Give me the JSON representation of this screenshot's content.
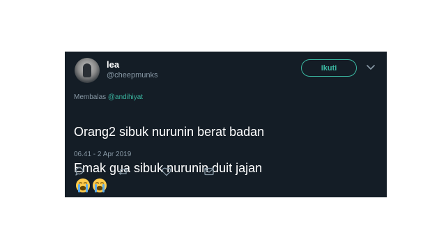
{
  "tweet": {
    "display_name": "lea",
    "handle": "@cheepmunks",
    "follow_label": "Ikuti",
    "reply_prefix": "Membalas ",
    "reply_to": "@andihiyat",
    "text_line1": "Orang2 sibuk nurunin berat badan",
    "text_line2": "Emak gua sibuk nurunin duit jajan",
    "emojis": [
      "loudly-crying-face",
      "loudly-crying-face"
    ],
    "timestamp": "06.41 - 2 Apr 2019"
  },
  "actions": [
    {
      "icon": "reply-icon"
    },
    {
      "icon": "retweet-icon"
    },
    {
      "icon": "like-icon"
    },
    {
      "icon": "message-icon"
    }
  ],
  "colors": {
    "card_background": "#141d26",
    "accent": "#3ab6a0",
    "muted": "#8899a6"
  }
}
